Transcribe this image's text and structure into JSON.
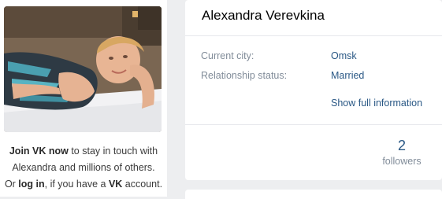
{
  "profile": {
    "name": "Alexandra Verevkina",
    "info": [
      {
        "label": "Current city:",
        "value": "Omsk"
      },
      {
        "label": "Relationship status:",
        "value": "Married"
      }
    ],
    "show_full_label": "Show full information",
    "followers_count": "2",
    "followers_label": "followers"
  },
  "join": {
    "join_link": "Join VK now",
    "text_1": " to stay in touch with",
    "text_2": "Alexandra and millions of others.",
    "text_3_prefix": "Or ",
    "login_link": "log in",
    "text_3_middle": ", if you have a ",
    "vk": "VK",
    "text_3_suffix": " account."
  },
  "colors": {
    "page_bg": "#edeef0",
    "card_bg": "#ffffff",
    "link": "#2a5885",
    "muted": "#818c99"
  }
}
